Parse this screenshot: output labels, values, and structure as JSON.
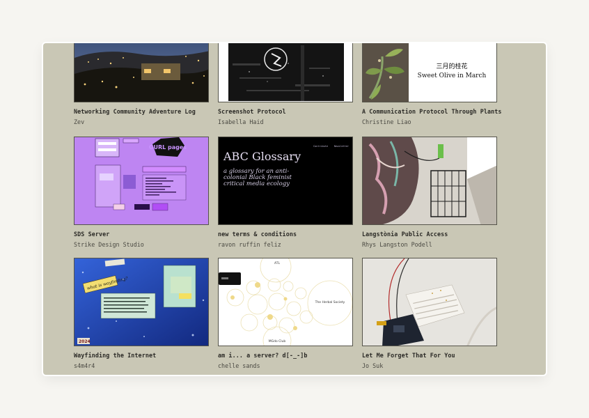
{
  "projects": [
    {
      "title": "Networking Community Adventure Log",
      "author": "Zev"
    },
    {
      "title": "Screenshot Protocol",
      "author": "Isabella Haid"
    },
    {
      "title": "A Communication Protocol Through Plants",
      "author": "Christine Liao",
      "thumb_text_zh": "三月的桂花",
      "thumb_text_en": "Sweet Olive in March"
    },
    {
      "title": "SDS Server",
      "author": "Strike Design Studio",
      "thumb_text": "GURL pages"
    },
    {
      "title": "new terms & conditions",
      "author": "ravon ruffin feliz",
      "thumb_title": "ABC Glossary",
      "thumb_sub1": "a glossary for an anti-",
      "thumb_sub2": "colonial Black feminist",
      "thumb_sub3": "critical media ecology",
      "thumb_nav1": "Contribute",
      "thumb_nav2": "Newsletter"
    },
    {
      "title": "Langstònia Public Access",
      "author": "Rhys Langston Podell"
    },
    {
      "title": "Wayfinding the Internet",
      "author": "s4m4r4",
      "thumb_tag": "2024",
      "thumb_note": "what is wayfinding?"
    },
    {
      "title": "am i... a server? d[-_-]b",
      "author": "chelle sands",
      "thumb_node1": "The Herbal Society",
      "thumb_node2": "MGdo Club",
      "thumb_node3": "ATL"
    },
    {
      "title": "Let Me Forget That For You",
      "author": "Jo Suk"
    }
  ],
  "colors": {
    "panel": "#c9c7b5",
    "page": "#f6f5f1",
    "text": "#2b2a26"
  }
}
